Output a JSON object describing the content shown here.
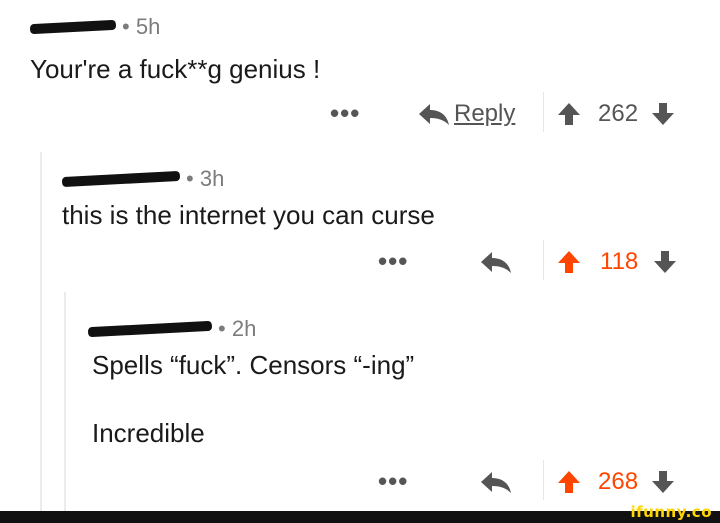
{
  "comments": [
    {
      "time": "5h",
      "text": "Your're a fuck**g genius !",
      "actions": {
        "more": "•••",
        "reply_label": "Reply",
        "score": "262"
      }
    },
    {
      "time": "3h",
      "text": "this is the internet you can curse",
      "actions": {
        "more": "•••",
        "score": "118",
        "upvoted": true
      }
    },
    {
      "time": "2h",
      "text_line1": "Spells “fuck”. Censors “-ing”",
      "text_line2": "Incredible",
      "actions": {
        "more": "•••",
        "score": "268",
        "upvoted": true
      }
    }
  ],
  "colors": {
    "upvote": "#ff4500",
    "text": "#1a1a1b",
    "meta": "#7c7c7c",
    "icon": "#555555"
  },
  "watermark": "ifunny.co"
}
